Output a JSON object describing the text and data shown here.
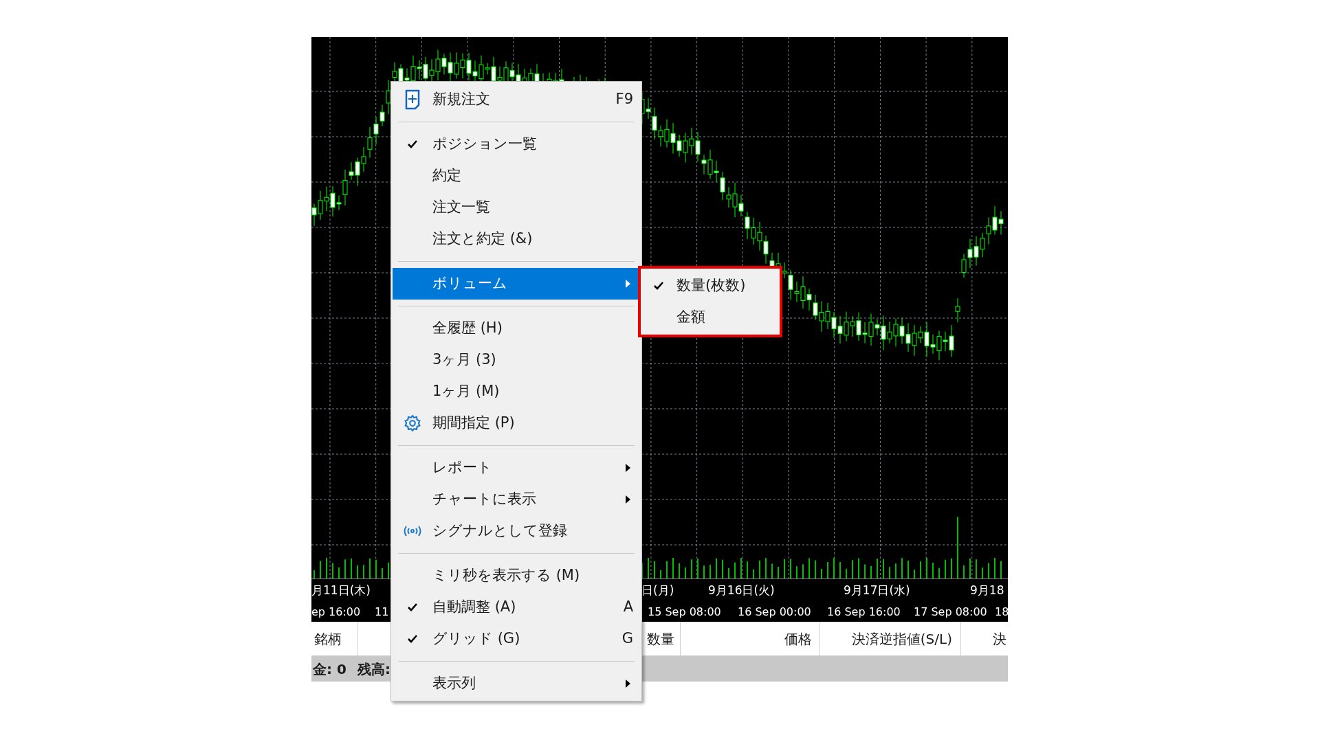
{
  "chart": {
    "axis": {
      "dates": [
        "月11日(木)",
        "日(月)",
        "9月16日(火)",
        "9月17日(水)",
        "9月18"
      ],
      "times": [
        "ep 16:00",
        "11",
        "15 Sep 08:00",
        "16 Sep 00:00",
        "16 Sep 16:00",
        "17 Sep 08:00",
        "18"
      ]
    }
  },
  "table": {
    "columns": [
      "銘柄",
      "数量",
      "価格",
      "決済逆指値(S/L)",
      "決"
    ]
  },
  "status_bar": [
    "金: 0",
    "残高:"
  ],
  "context_menu": {
    "items": [
      {
        "kind": "new",
        "label": "新規注文",
        "shortcut": "F9",
        "checked": false,
        "selected": false,
        "submenu": false
      },
      {
        "kind": "separator"
      },
      {
        "kind": "plain",
        "label": "ポジション一覧",
        "checked": true,
        "selected": false,
        "submenu": false
      },
      {
        "kind": "plain",
        "label": "約定",
        "checked": false,
        "selected": false,
        "submenu": false
      },
      {
        "kind": "plain",
        "label": "注文一覧",
        "checked": false,
        "selected": false,
        "submenu": false
      },
      {
        "kind": "plain",
        "label": "注文と約定 (&)",
        "checked": false,
        "selected": false,
        "submenu": false
      },
      {
        "kind": "separator"
      },
      {
        "kind": "plain",
        "label": "ボリューム",
        "checked": false,
        "selected": true,
        "submenu": true
      },
      {
        "kind": "separator"
      },
      {
        "kind": "plain",
        "label": "全履歴 (H)",
        "checked": false,
        "selected": false,
        "submenu": false
      },
      {
        "kind": "plain",
        "label": "3ヶ月 (3)",
        "checked": false,
        "selected": false,
        "submenu": false
      },
      {
        "kind": "plain",
        "label": "1ヶ月 (M)",
        "checked": false,
        "selected": false,
        "submenu": false
      },
      {
        "kind": "settings",
        "label": "期間指定 (P)",
        "checked": false,
        "selected": false,
        "submenu": false
      },
      {
        "kind": "separator"
      },
      {
        "kind": "plain",
        "label": "レポート",
        "checked": false,
        "selected": false,
        "submenu": true
      },
      {
        "kind": "plain",
        "label": "チャートに表示",
        "checked": false,
        "selected": false,
        "submenu": true
      },
      {
        "kind": "signal",
        "label": "シグナルとして登録",
        "checked": false,
        "selected": false,
        "submenu": false
      },
      {
        "kind": "separator"
      },
      {
        "kind": "plain",
        "label": "ミリ秒を表示する (M)",
        "checked": false,
        "selected": false,
        "submenu": false
      },
      {
        "kind": "plain",
        "label": "自動調整 (A)",
        "shortcut": "A",
        "checked": true,
        "selected": false,
        "submenu": false
      },
      {
        "kind": "plain",
        "label": "グリッド (G)",
        "shortcut": "G",
        "checked": true,
        "selected": false,
        "submenu": false
      },
      {
        "kind": "separator"
      },
      {
        "kind": "plain",
        "label": "表示列",
        "checked": false,
        "selected": false,
        "submenu": true
      }
    ]
  },
  "submenu": {
    "items": [
      {
        "label": "数量(枚数)",
        "checked": true
      },
      {
        "label": "金額",
        "checked": false
      }
    ]
  }
}
